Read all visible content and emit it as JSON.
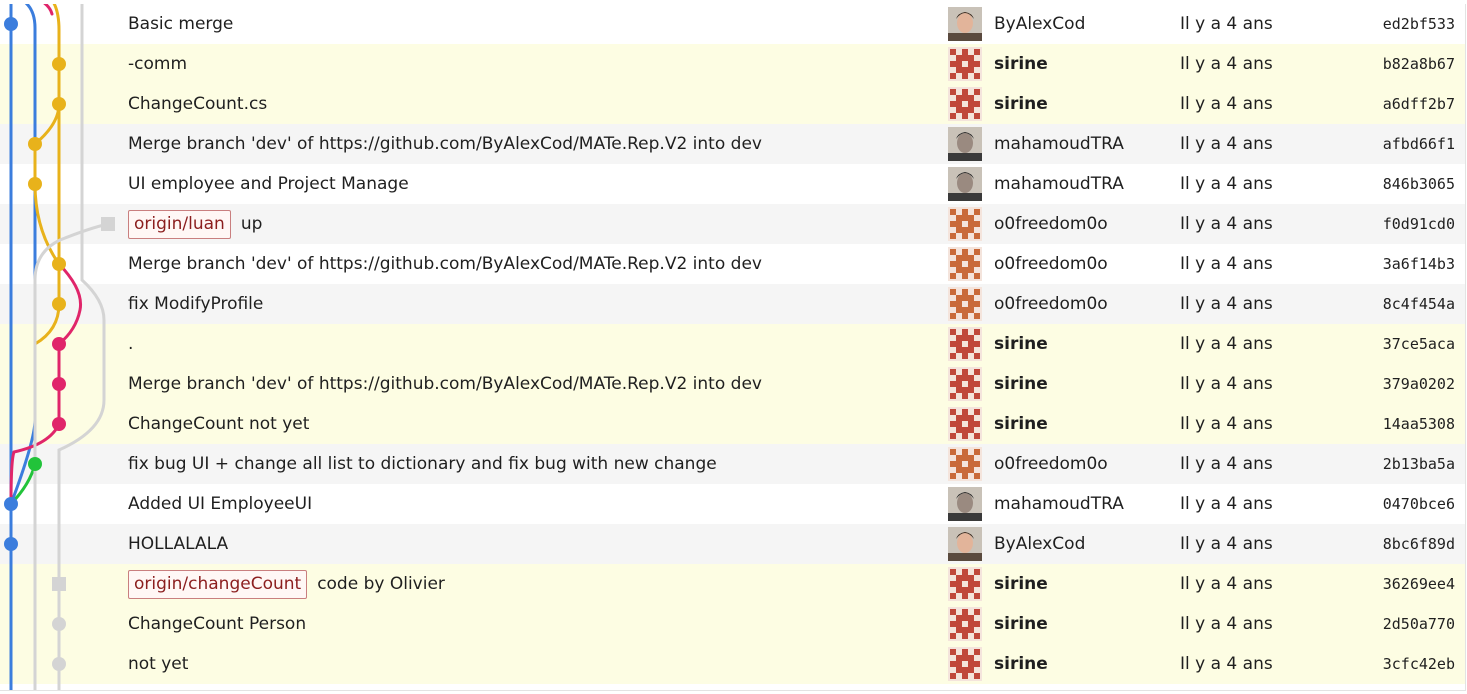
{
  "colors": {
    "row_yellow": "#fdfde3",
    "row_gray": "#f5f5f5",
    "lane_blue": "#3b7ddd",
    "lane_yellow": "#e8b21b",
    "lane_pink": "#e0256a",
    "lane_gray": "#d4d4d4",
    "lane_green": "#22c33a",
    "ref_border": "#c97f7f",
    "ref_text": "#8b1e1e"
  },
  "commits": [
    {
      "message": "Basic merge",
      "ref": "",
      "author": "ByAlexCod",
      "author_bold": false,
      "avatar": "photo-alex-icon",
      "date": "Il y a 4 ans",
      "sha": "ed2bf533",
      "bg": "white"
    },
    {
      "message": "-comm",
      "ref": "",
      "author": "sirine",
      "author_bold": true,
      "avatar": "identicon-red-icon",
      "date": "Il y a 4 ans",
      "sha": "b82a8b67",
      "bg": "yellow"
    },
    {
      "message": "ChangeCount.cs",
      "ref": "",
      "author": "sirine",
      "author_bold": true,
      "avatar": "identicon-red-icon",
      "date": "Il y a 4 ans",
      "sha": "a6dff2b7",
      "bg": "yellow"
    },
    {
      "message": "Merge branch 'dev' of https://github.com/ByAlexCod/MATe.Rep.V2 into dev",
      "ref": "",
      "author": "mahamoudTRA",
      "author_bold": false,
      "avatar": "photo-mahamoud-icon",
      "date": "Il y a 4 ans",
      "sha": "afbd66f1",
      "bg": "gray"
    },
    {
      "message": "UI employee and Project Manage",
      "ref": "",
      "author": "mahamoudTRA",
      "author_bold": false,
      "avatar": "photo-mahamoud-icon",
      "date": "Il y a 4 ans",
      "sha": "846b3065",
      "bg": "white"
    },
    {
      "message": "up",
      "ref": "origin/luan",
      "author": "o0freedom0o",
      "author_bold": false,
      "avatar": "identicon-orange-icon",
      "date": "Il y a 4 ans",
      "sha": "f0d91cd0",
      "bg": "gray"
    },
    {
      "message": "Merge branch 'dev' of https://github.com/ByAlexCod/MATe.Rep.V2 into dev",
      "ref": "",
      "author": "o0freedom0o",
      "author_bold": false,
      "avatar": "identicon-orange-icon",
      "date": "Il y a 4 ans",
      "sha": "3a6f14b3",
      "bg": "white"
    },
    {
      "message": "fix ModifyProfile",
      "ref": "",
      "author": "o0freedom0o",
      "author_bold": false,
      "avatar": "identicon-orange-icon",
      "date": "Il y a 4 ans",
      "sha": "8c4f454a",
      "bg": "gray"
    },
    {
      "message": ".",
      "ref": "",
      "author": "sirine",
      "author_bold": true,
      "avatar": "identicon-red-icon",
      "date": "Il y a 4 ans",
      "sha": "37ce5aca",
      "bg": "yellow"
    },
    {
      "message": "Merge branch 'dev' of https://github.com/ByAlexCod/MATe.Rep.V2 into dev",
      "ref": "",
      "author": "sirine",
      "author_bold": true,
      "avatar": "identicon-red-icon",
      "date": "Il y a 4 ans",
      "sha": "379a0202",
      "bg": "yellow"
    },
    {
      "message": "ChangeCount not yet",
      "ref": "",
      "author": "sirine",
      "author_bold": true,
      "avatar": "identicon-red-icon",
      "date": "Il y a 4 ans",
      "sha": "14aa5308",
      "bg": "yellow"
    },
    {
      "message": "fix bug UI + change all list to dictionary and fix bug with new change",
      "ref": "",
      "author": "o0freedom0o",
      "author_bold": false,
      "avatar": "identicon-orange-icon",
      "date": "Il y a 4 ans",
      "sha": "2b13ba5a",
      "bg": "gray"
    },
    {
      "message": "Added UI EmployeeUI",
      "ref": "",
      "author": "mahamoudTRA",
      "author_bold": false,
      "avatar": "photo-mahamoud-icon",
      "date": "Il y a 4 ans",
      "sha": "0470bce6",
      "bg": "white"
    },
    {
      "message": "HOLLALALA",
      "ref": "",
      "author": "ByAlexCod",
      "author_bold": false,
      "avatar": "photo-alex-icon",
      "date": "Il y a 4 ans",
      "sha": "8bc6f89d",
      "bg": "gray"
    },
    {
      "message": "code by Olivier",
      "ref": "origin/changeCount",
      "author": "sirine",
      "author_bold": true,
      "avatar": "identicon-red-icon",
      "date": "Il y a 4 ans",
      "sha": "36269ee4",
      "bg": "yellow"
    },
    {
      "message": "ChangeCount Person",
      "ref": "",
      "author": "sirine",
      "author_bold": true,
      "avatar": "identicon-red-icon",
      "date": "Il y a 4 ans",
      "sha": "2d50a770",
      "bg": "yellow"
    },
    {
      "message": "not yet",
      "ref": "",
      "author": "sirine",
      "author_bold": true,
      "avatar": "identicon-red-icon",
      "date": "Il y a 4 ans",
      "sha": "3cfc42eb",
      "bg": "yellow"
    }
  ]
}
